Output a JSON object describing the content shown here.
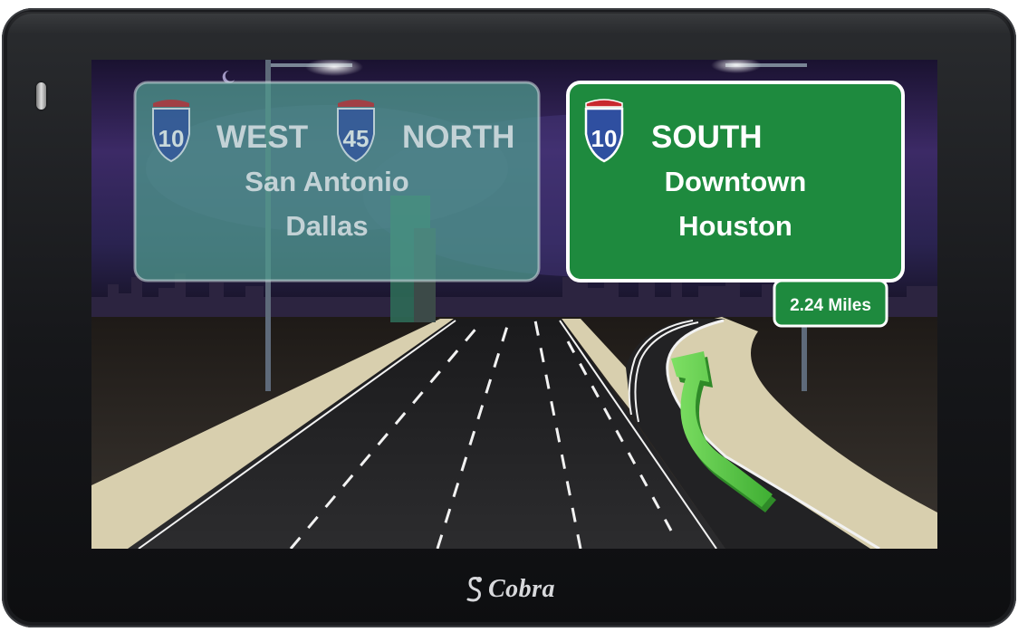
{
  "device": {
    "brand": "Cobra",
    "brand_icon": "cobra-snake-logo-icon"
  },
  "left_sign": {
    "routes": [
      {
        "shield_number": "10",
        "direction": "WEST"
      },
      {
        "shield_number": "45",
        "direction": "NORTH"
      }
    ],
    "destinations": [
      "San Antonio",
      "Dallas"
    ]
  },
  "right_sign": {
    "shield_number": "10",
    "direction": "SOUTH",
    "destinations": [
      "Downtown",
      "Houston"
    ],
    "distance": "2.24 Miles"
  },
  "colors": {
    "sign_green": "#1e8a3e",
    "sign_faded": "#4f9a8e",
    "shield_blue": "#2f4fa0",
    "shield_red": "#c8282e",
    "arrow_green": "#5ed04a",
    "sky_purple": "#3c2a66"
  }
}
